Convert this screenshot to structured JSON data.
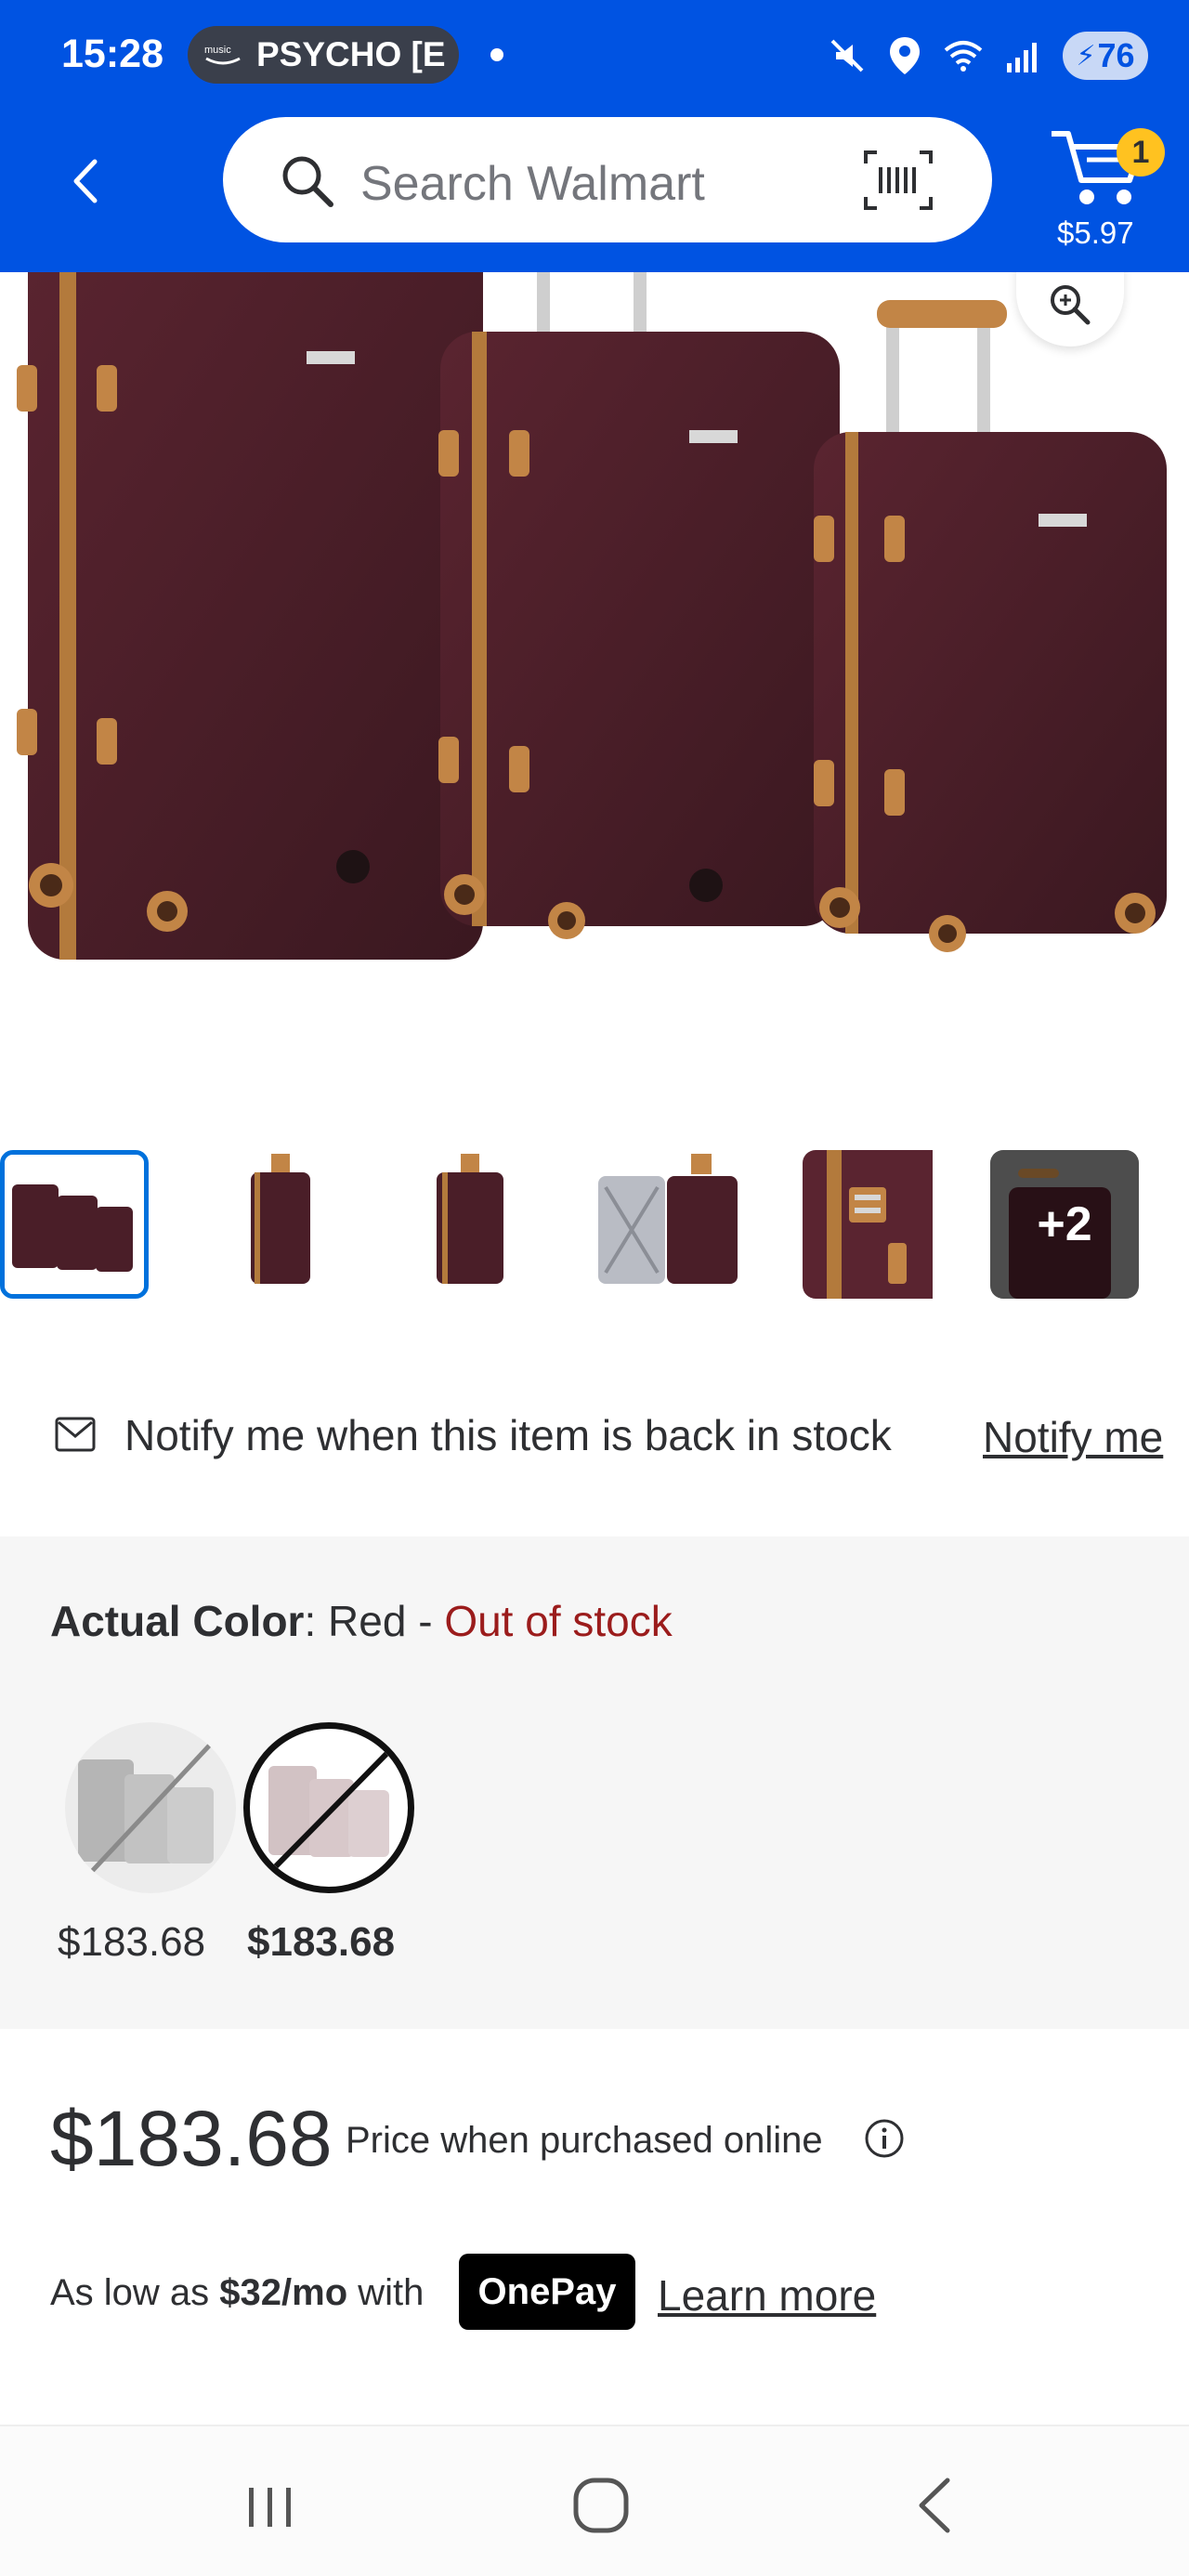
{
  "status_bar": {
    "time": "15:28",
    "music_label": "PSYCHO [E",
    "battery": "76"
  },
  "header": {
    "search_placeholder": "Search Walmart",
    "cart_count": "1",
    "cart_total": "$5.97",
    "colors": {
      "brand_blue": "#0053e2",
      "badge_yellow": "#ffc220"
    }
  },
  "gallery": {
    "more_count": "+2"
  },
  "notify": {
    "text": "Notify me when this item is back in stock",
    "link": "Notify me"
  },
  "variant": {
    "label": "Actual Color",
    "value": "Red",
    "separator": " - ",
    "status": "Out of stock",
    "options": [
      {
        "price": "$183.68",
        "selected": false
      },
      {
        "price": "$183.68",
        "selected": true
      }
    ]
  },
  "pricing": {
    "price": "$183.68",
    "note": "Price when purchased online",
    "as_low_as_prefix": "As low as ",
    "monthly": "$32/mo",
    "with": " with",
    "onepay": "OnePay",
    "learn_more": "Learn more"
  }
}
